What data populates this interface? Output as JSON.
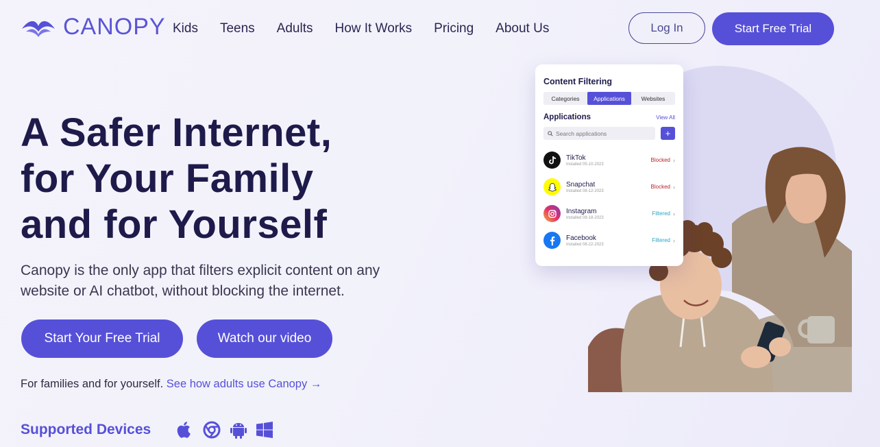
{
  "header": {
    "brand": "CANOPY",
    "nav": [
      "Kids",
      "Teens",
      "Adults",
      "How It Works",
      "Pricing",
      "About Us"
    ],
    "login_label": "Log In",
    "trial_label": "Start Free Trial"
  },
  "hero": {
    "title_lines": [
      "A Safer Internet,",
      "for Your Family",
      "and for Yourself"
    ],
    "subtitle": "Canopy is the only app that filters explicit content on any website or AI chatbot, without blocking the internet.",
    "cta_primary": "Start Your Free Trial",
    "cta_secondary": "Watch our video",
    "families_text": "For families and for yourself.",
    "families_link": "See how adults use Canopy →",
    "devices_label": "Supported Devices",
    "device_icons": [
      "apple-icon",
      "chrome-icon",
      "android-icon",
      "windows-icon"
    ]
  },
  "card": {
    "title": "Content Filtering",
    "tabs": [
      "Categories",
      "Applications",
      "Websites"
    ],
    "active_tab": "Applications",
    "section_title": "Applications",
    "view_all": "View All",
    "search_placeholder": "Search applications",
    "add_label": "+",
    "apps": [
      {
        "name": "TikTok",
        "date": "Installed 05-10-2023",
        "status": "Blocked",
        "icon": "tiktok-icon"
      },
      {
        "name": "Snapchat",
        "date": "Installed 08-12-2023",
        "status": "Blocked",
        "icon": "snapchat-icon"
      },
      {
        "name": "Instagram",
        "date": "Installed 08-18-2023",
        "status": "Filtered",
        "icon": "instagram-icon"
      },
      {
        "name": "Facebook",
        "date": "Installed 08-22-2023",
        "status": "Filtered",
        "icon": "facebook-icon"
      }
    ]
  },
  "colors": {
    "brand": "#5650d8",
    "heading": "#1e1b4b",
    "blocked": "#b8262a",
    "filtered": "#2aa5c9"
  }
}
